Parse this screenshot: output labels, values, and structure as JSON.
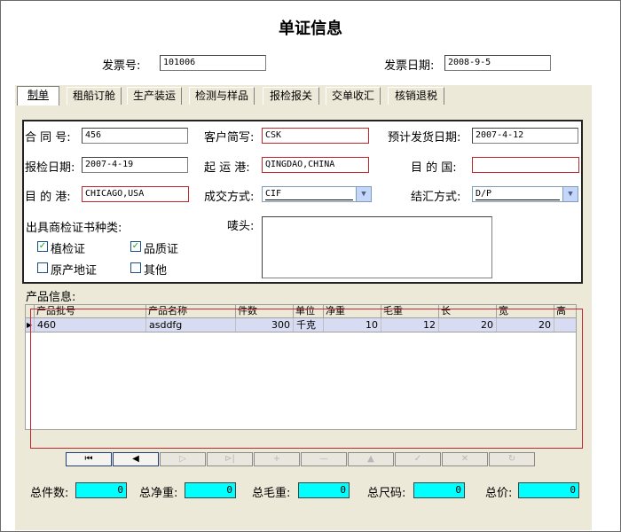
{
  "title": "单证信息",
  "header": {
    "invoice_no_label": "发票号:",
    "invoice_no": "101006",
    "invoice_date_label": "发票日期:",
    "invoice_date": "2008-9-5"
  },
  "tabs": [
    {
      "label": "制单"
    },
    {
      "label": "租船订舱"
    },
    {
      "label": "生产装运"
    },
    {
      "label": "检测与样品"
    },
    {
      "label": "报检报关"
    },
    {
      "label": "交单收汇"
    },
    {
      "label": "核销退税"
    }
  ],
  "form": {
    "contract_no_label": "合 同 号:",
    "contract_no": "456",
    "customer_label": "客户简写:",
    "customer": "CSK",
    "ship_date_label": "预计发货日期:",
    "ship_date": "2007-4-12",
    "inspect_date_label": "报检日期:",
    "inspect_date": "2007-4-19",
    "load_port_label": "起 运 港:",
    "load_port": "QINGDAO,CHINA",
    "dest_country_label": "目 的 国:",
    "dest_country": "",
    "dest_port_label": "目 的 港:",
    "dest_port": "CHICAGO,USA",
    "deal_label": "成交方式:",
    "deal": "CIF",
    "payment_label": "结汇方式:",
    "payment": "D/P",
    "cert_label": "出具商检证书种类:",
    "mark_label": "唛头:",
    "mark": "",
    "certs": [
      {
        "label": "植检证",
        "checked": true
      },
      {
        "label": "品质证",
        "checked": true
      },
      {
        "label": "原产地证",
        "checked": false
      },
      {
        "label": "其他",
        "checked": false
      }
    ]
  },
  "products": {
    "section_label": "产品信息:",
    "columns": [
      "产品批号",
      "产品名称",
      "件数",
      "单位",
      "净重",
      "毛重",
      "长",
      "宽",
      "高"
    ],
    "rows": [
      {
        "batch": "460",
        "name": "asddfg",
        "count": "300",
        "unit": "千克",
        "net": "10",
        "gross": "12",
        "length": "20",
        "width": "20",
        "height": ""
      }
    ]
  },
  "navigator": {
    "first": "⏮",
    "prev": "◀",
    "next": "▷",
    "last": "⊳|",
    "insert": "+",
    "delete": "—",
    "edit": "▲",
    "post": "✓",
    "cancel": "✕",
    "refresh": "↻"
  },
  "totals": {
    "count_label": "总件数:",
    "count": "0",
    "net_label": "总净重:",
    "net": "0",
    "gross_label": "总毛重:",
    "gross": "0",
    "volume_label": "总尺码:",
    "volume": "0",
    "price_label": "总价:",
    "price": "0"
  },
  "colors": {
    "highlight_border": "#c0282d",
    "totals_bg": "#00ffff",
    "row_selected": "#d7dcf3"
  }
}
